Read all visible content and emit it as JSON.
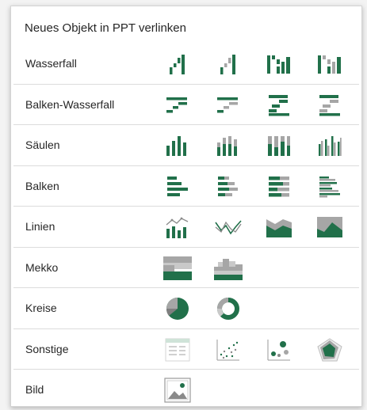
{
  "panel": {
    "title": "Neues Objekt in PPT verlinken"
  },
  "colors": {
    "green": "#21704a",
    "gray": "#a6a6a6",
    "light_gray": "#c9c9c9"
  },
  "rows": [
    {
      "label": "Wasserfall",
      "icons": [
        "waterfall-icon",
        "waterfall-gray-icon",
        "waterfall-stacked-icon",
        "waterfall-stacked-gray-icon"
      ]
    },
    {
      "label": "Balken-Wasserfall",
      "icons": [
        "bar-waterfall-icon",
        "bar-waterfall-gray-icon",
        "bar-waterfall-stacked-icon",
        "bar-waterfall-stacked-gray-icon"
      ]
    },
    {
      "label": "Säulen",
      "icons": [
        "column-icon",
        "column-stacked-icon",
        "column-100-icon",
        "column-clustered-icon"
      ]
    },
    {
      "label": "Balken",
      "icons": [
        "bar-icon",
        "bar-stacked-icon",
        "bar-100-icon",
        "bar-clustered-icon"
      ]
    },
    {
      "label": "Linien",
      "icons": [
        "line-column-icon",
        "line-icon",
        "area-icon",
        "area-100-icon"
      ]
    },
    {
      "label": "Mekko",
      "icons": [
        "mekko-icon",
        "mekko-stacked-icon"
      ]
    },
    {
      "label": "Kreise",
      "icons": [
        "pie-icon",
        "doughnut-icon"
      ]
    },
    {
      "label": "Sonstige",
      "icons": [
        "table-icon",
        "scatter-icon",
        "bubble-icon",
        "radar-icon"
      ]
    },
    {
      "label": "Bild",
      "icons": [
        "image-icon"
      ]
    }
  ]
}
